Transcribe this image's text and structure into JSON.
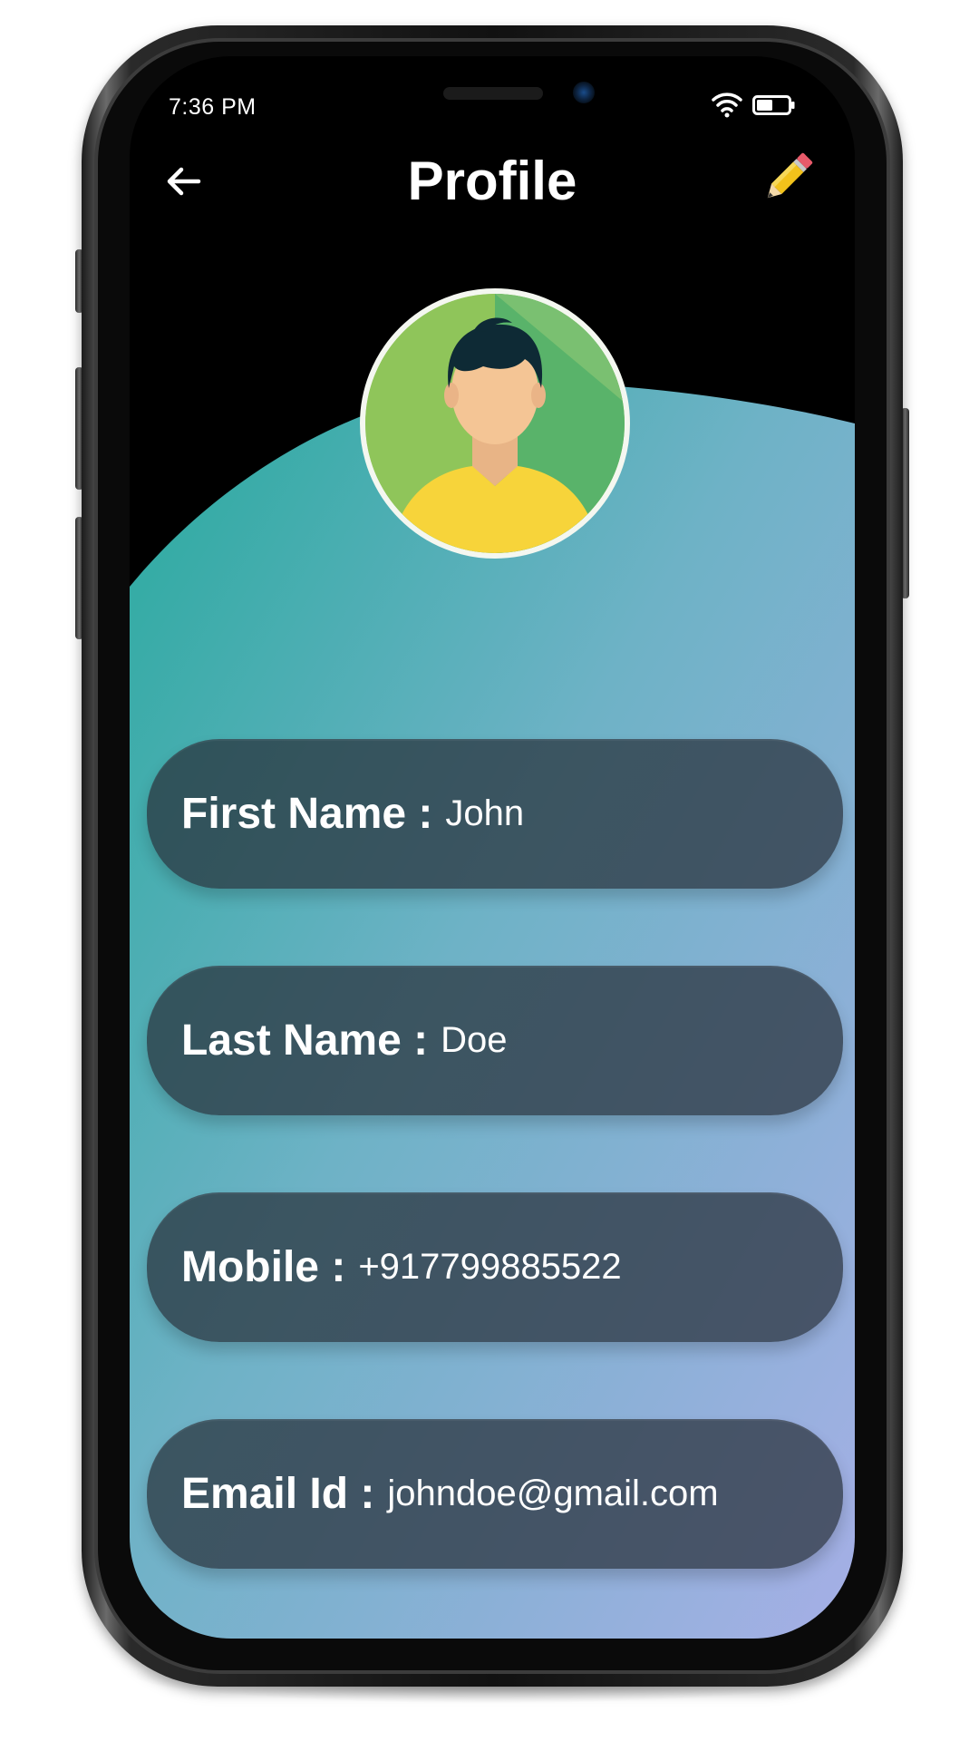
{
  "status_bar": {
    "time": "7:36 PM",
    "wifi_icon": "wifi-icon",
    "battery_icon": "battery-icon"
  },
  "header": {
    "title": "Profile",
    "back_icon": "arrow-left-icon",
    "edit_icon": "pencil-icon"
  },
  "avatar": {
    "icon": "user-avatar-illustration"
  },
  "fields": [
    {
      "label": "First Name :",
      "value": "John"
    },
    {
      "label": "Last Name :",
      "value": "Doe"
    },
    {
      "label": "Mobile :",
      "value": "+917799885522"
    },
    {
      "label": "Email Id :",
      "value": "johndoe@gmail.com"
    }
  ],
  "colors": {
    "screen_background": "#000000",
    "gradient_start": "#2aa9a0",
    "gradient_end": "#a3b0e4",
    "card_background": "#2f3a44",
    "pencil_yellow": "#f2c21b"
  }
}
